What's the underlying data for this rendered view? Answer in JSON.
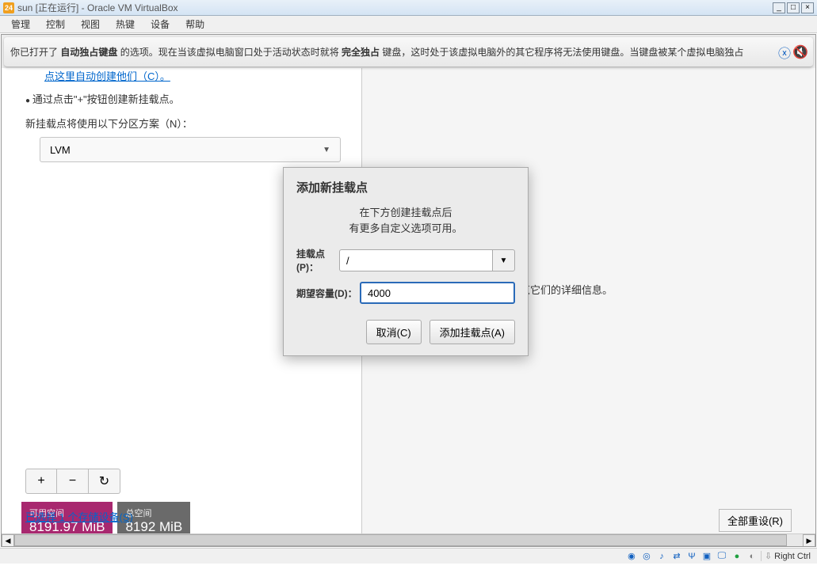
{
  "titlebar": {
    "vm_name": "sun [正在运行] - Oracle VM VirtualBox",
    "min": "_",
    "max": "□",
    "close": "×"
  },
  "menubar": [
    "管理",
    "控制",
    "视图",
    "热键",
    "设备",
    "帮助"
  ],
  "notify": {
    "prefix": "你已打开了 ",
    "b1": "自动独占键盘",
    "mid1": " 的选项。现在当该虚拟电脑窗口处于活动状态时就将 ",
    "b2": "完全独占",
    "mid2": " 键盘，这时处于该虚拟电脑外的其它程序将无法使用键盘。当键盘被某个虚拟电脑独占"
  },
  "installer": {
    "link_auto": "点这里自动创建他们（C）。",
    "bullet": "通过点击\"+\"按钮创建新挂载点。",
    "scheme_label": "新挂载点将使用以下分区方案（N）：",
    "scheme_value": "LVM",
    "btn_plus": "+",
    "btn_minus": "−",
    "btn_reload": "↻",
    "free_label": "可用空间",
    "free_value": "8191.97 MiB",
    "total_label": "总空间",
    "total_value": "8192 MiB",
    "selected_devices": "已选择 1 个存储设备(S)",
    "reset_all": "全部重设(R)",
    "right_hint": "创建挂载点后，您可在这里浏览它们的详细信息。"
  },
  "modal": {
    "title": "添加新挂载点",
    "desc_l1": "在下方创建挂载点后",
    "desc_l2": "有更多自定义选项可用。",
    "mount_label": "挂载点(P)：",
    "mount_value": "/",
    "capacity_label": "期望容量(D)：",
    "capacity_value": "4000",
    "cancel": "取消(C)",
    "add": "添加挂载点(A)"
  },
  "statusbar": {
    "host_key": "Right Ctrl"
  }
}
